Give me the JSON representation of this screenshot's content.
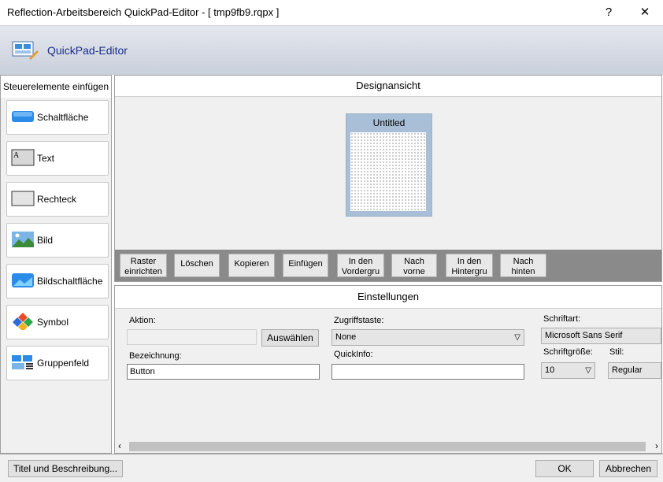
{
  "window": {
    "title": "Reflection-Arbeitsbereich QuickPad-Editor - [ tmp9fb9.rqpx ]",
    "help": "?",
    "close": "✕"
  },
  "header": {
    "title": "QuickPad-Editor",
    "icon": "quickpad-editor-icon"
  },
  "controls": {
    "caption": "Steuerelemente einfügen",
    "items": [
      {
        "label": "Schaltfläche",
        "icon": "button-control-icon"
      },
      {
        "label": "Text",
        "icon": "text-control-icon"
      },
      {
        "label": "Rechteck",
        "icon": "rectangle-control-icon"
      },
      {
        "label": "Bild",
        "icon": "image-control-icon"
      },
      {
        "label": "Bildschaltfläche",
        "icon": "image-button-control-icon"
      },
      {
        "label": "Symbol",
        "icon": "symbol-control-icon"
      },
      {
        "label": "Gruppenfeld",
        "icon": "group-box-control-icon"
      }
    ]
  },
  "design": {
    "caption": "Designansicht",
    "pad_title": "Untitled",
    "buttons": [
      {
        "line1": "Raster",
        "line2": "einrichten"
      },
      {
        "line1": "Löschen",
        "line2": ""
      },
      {
        "line1": "Kopieren",
        "line2": ""
      },
      {
        "line1": "Einfügen",
        "line2": ""
      },
      {
        "line1": "In den",
        "line2": "Vordergru"
      },
      {
        "line1": "Nach",
        "line2": "vorne"
      },
      {
        "line1": "In den",
        "line2": "Hintergru"
      },
      {
        "line1": "Nach",
        "line2": "hinten"
      }
    ]
  },
  "settings": {
    "caption": "Einstellungen",
    "action_label": "Aktion:",
    "action_value": "",
    "select_button": "Auswählen",
    "name_label": "Bezeichnung:",
    "name_value": "Button",
    "shortcut_label": "Zugriffstaste:",
    "shortcut_value": "None",
    "quickinfo_label": "QuickInfo:",
    "quickinfo_value": "",
    "font_label": "Schriftart:",
    "font_value": "Microsoft Sans Serif",
    "size_label": "Schriftgröße:",
    "size_value": "10",
    "style_label": "Stil:",
    "style_value": "Regular"
  },
  "footer": {
    "title_desc_button": "Titel und Beschreibung...",
    "ok_button": "OK",
    "cancel_button": "Abbrechen"
  }
}
